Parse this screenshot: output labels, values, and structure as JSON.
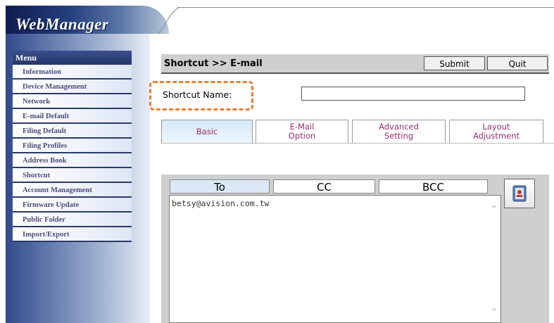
{
  "app": {
    "logo": "WebManager"
  },
  "menu": {
    "header": "Menu",
    "items": [
      {
        "label": "Information"
      },
      {
        "label": "Device Management"
      },
      {
        "label": "Network"
      },
      {
        "label": "E-mail Default"
      },
      {
        "label": "Filing Default"
      },
      {
        "label": "Filing Profiles"
      },
      {
        "label": "Address Book"
      },
      {
        "label": "Shortcut"
      },
      {
        "label": "Account Management"
      },
      {
        "label": "Firmware Update"
      },
      {
        "label": "Public Folder"
      },
      {
        "label": "Import/Export"
      }
    ]
  },
  "header": {
    "breadcrumb": "Shortcut >> E-mail",
    "submit_label": "Submit",
    "quit_label": "Quit"
  },
  "shortcut": {
    "label": "Shortcut Name:",
    "value": ""
  },
  "tabs": [
    {
      "line1": "Basic",
      "line2": "",
      "active": true
    },
    {
      "line1": "E-Mail",
      "line2": "Option",
      "active": false
    },
    {
      "line1": "Advanced",
      "line2": "Setting",
      "active": false
    },
    {
      "line1": "Layout",
      "line2": "Adjustment",
      "active": false
    }
  ],
  "recipients": {
    "tabs": [
      {
        "label": "To",
        "active": true
      },
      {
        "label": "CC",
        "active": false
      },
      {
        "label": "BCC",
        "active": false
      }
    ],
    "text": "betsy@avision.com.tw"
  },
  "icons": {
    "address_book": "address-book-icon",
    "scroll_up": "scroll-up-icon",
    "scroll_down": "scroll-down-icon"
  },
  "colors": {
    "highlight": "#ed7d31",
    "menu_header": "#243669",
    "tab_text": "#9b2d6b",
    "active_tab": "#dbe9f7"
  }
}
